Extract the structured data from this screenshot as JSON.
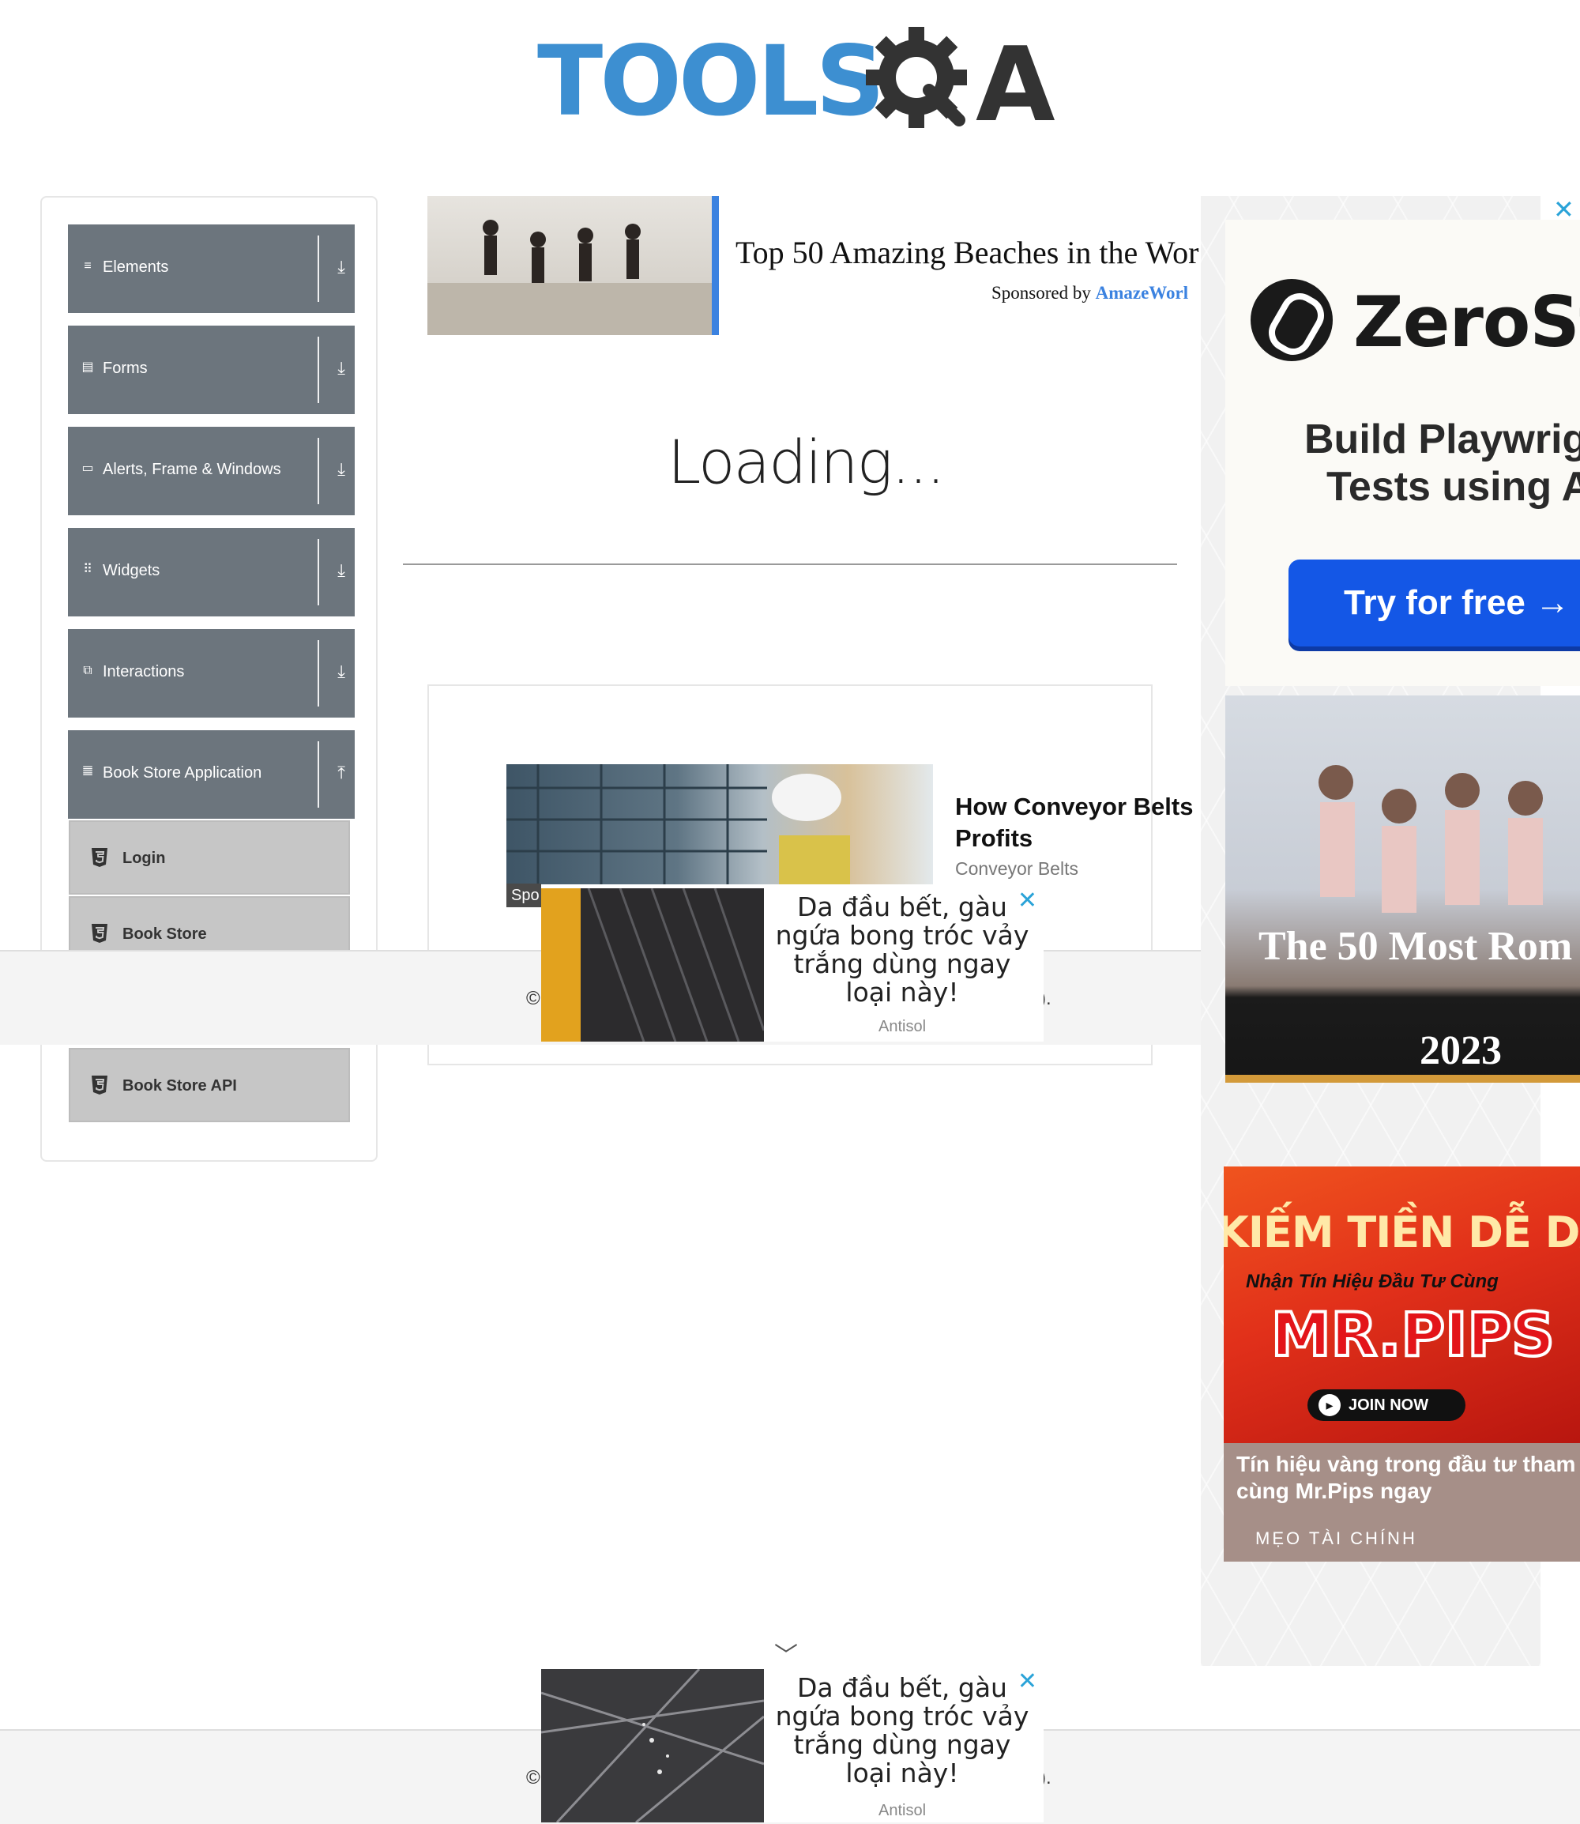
{
  "logo": {
    "tools_text": "TOOLS",
    "qa_text": "A"
  },
  "sidebar": {
    "groups": [
      {
        "label": "Elements",
        "icon": "≡",
        "arrow": "⤓"
      },
      {
        "label": "Forms",
        "icon": "▤",
        "arrow": "⤓"
      },
      {
        "label": "Alerts, Frame & Windows",
        "icon": "▭",
        "arrow": "⤓"
      },
      {
        "label": "Widgets",
        "icon": "⠿",
        "arrow": "⤓"
      },
      {
        "label": "Interactions",
        "icon": "⧉",
        "arrow": "⤓"
      },
      {
        "label": "Book Store Application",
        "icon": "𝍤",
        "arrow": "⤒"
      }
    ],
    "book_store_items": [
      {
        "label": "Login"
      },
      {
        "label": "Book Store"
      },
      {
        "label": "Book Store API"
      }
    ]
  },
  "ad_top": {
    "title": "Top 50 Amazing Beaches in the Wor",
    "sponsor_prefix": "Sponsored by",
    "sponsor_name": "AmazeWorl"
  },
  "main": {
    "loading_text": "Loading..."
  },
  "ad_conveyor": {
    "title": "How Conveyor Belts Profits",
    "subtitle": "Conveyor Belts",
    "tag": "Spo"
  },
  "footer": {
    "left_text": "©",
    "right_text": ")."
  },
  "ad_antisol": {
    "text": "Da đầu bết, gàu ngứa bong tróc vảy trắng dùng ngay loại này!",
    "brand": "Antisol",
    "close": "✕"
  },
  "right_ads": {
    "close": "✕",
    "zero": {
      "brand": "ZeroSt",
      "line1": "Build Playwrig",
      "line2": "Tests using A",
      "button": "Try for free →"
    },
    "party": {
      "title": "The 50 Most Rom",
      "year": "2023"
    },
    "pips": {
      "headline": "KIẾM TIỀN DỄ DÀNG",
      "subline": "Nhận Tín Hiệu Đầu Tư Cùng",
      "brand": "MR.PIPS",
      "join": "JOIN NOW",
      "text": "Tín hiệu vàng trong đầu tư tham cùng Mr.Pips ngay",
      "category": "MẸO TÀI CHÍNH"
    }
  },
  "scroll": {
    "chevron": "﹀"
  }
}
